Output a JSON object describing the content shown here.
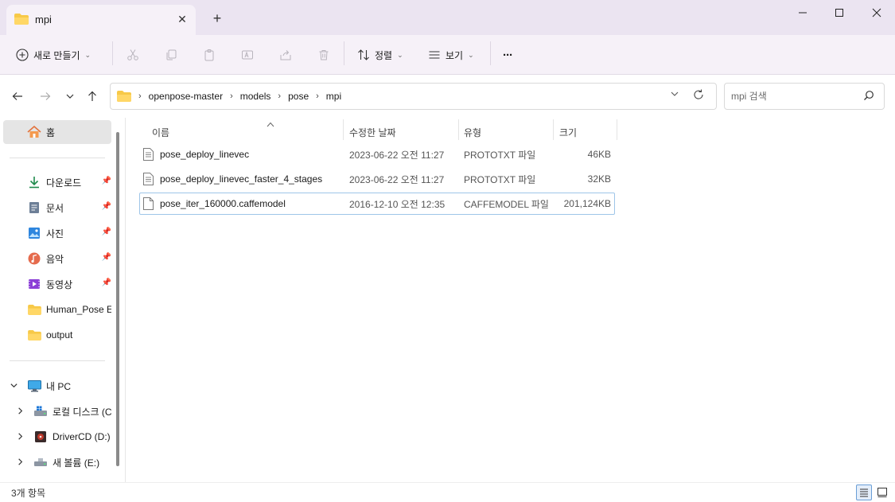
{
  "window": {
    "tab_title": "mpi",
    "tab_close": "✕",
    "new_tab": "+"
  },
  "toolbar": {
    "new_label": "새로 만들기",
    "sort_label": "정렬",
    "view_label": "보기",
    "more_label": "···"
  },
  "breadcrumb": [
    "openpose-master",
    "models",
    "pose",
    "mpi"
  ],
  "search": {
    "placeholder": "mpi 검색"
  },
  "sidebar": {
    "home": "홈",
    "quick": [
      {
        "label": "다운로드",
        "icon": "download-icon",
        "pinned": true
      },
      {
        "label": "문서",
        "icon": "document-icon",
        "pinned": true
      },
      {
        "label": "사진",
        "icon": "pictures-icon",
        "pinned": true
      },
      {
        "label": "음악",
        "icon": "music-icon",
        "pinned": true
      },
      {
        "label": "동영상",
        "icon": "video-icon",
        "pinned": true
      },
      {
        "label": "Human_Pose Es",
        "icon": "folder-icon",
        "pinned": false
      },
      {
        "label": "output",
        "icon": "folder-icon",
        "pinned": false
      }
    ],
    "this_pc": "내 PC",
    "drives": [
      {
        "label": "로컬 디스크 (C",
        "icon": "local-disk-icon"
      },
      {
        "label": "DriverCD (D:)",
        "icon": "cd-drive-icon"
      },
      {
        "label": "새 볼륨 (E:)",
        "icon": "usb-drive-icon"
      }
    ]
  },
  "columns": {
    "name": "이름",
    "date": "수정한 날짜",
    "type": "유형",
    "size": "크기"
  },
  "files": [
    {
      "name": "pose_deploy_linevec",
      "date": "2023-06-22 오전 11:27",
      "type": "PROTOTXT 파일",
      "size": "46KB"
    },
    {
      "name": "pose_deploy_linevec_faster_4_stages",
      "date": "2023-06-22 오전 11:27",
      "type": "PROTOTXT 파일",
      "size": "32KB"
    },
    {
      "name": "pose_iter_160000.caffemodel",
      "date": "2016-12-10 오전 12:35",
      "type": "CAFFEMODEL 파일",
      "size": "201,124KB"
    }
  ],
  "status": {
    "item_count": "3개 항목"
  },
  "colors": {
    "titlebar": "#ebe4f1",
    "commandbar": "#f6f1f8",
    "accent": "#0067c0",
    "folder": "#f7c948",
    "focus_border": "#9ec5e8"
  }
}
